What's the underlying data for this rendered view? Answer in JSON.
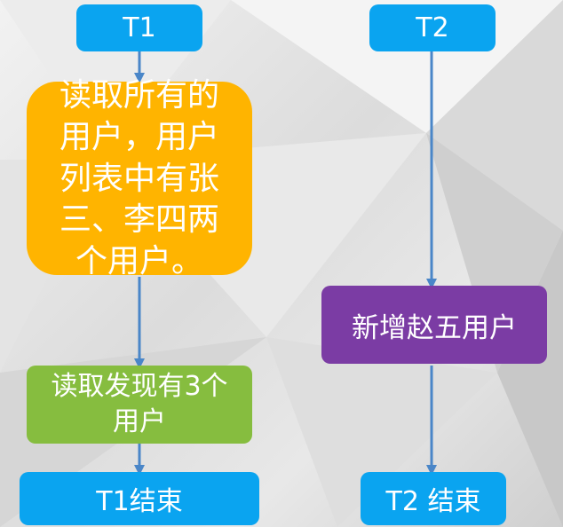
{
  "diagram": {
    "t1_label": "T1",
    "t2_label": "T2",
    "t1_step1_lines": [
      "读取所有的",
      "用户，用户",
      "列表中有张",
      "三、李四两",
      "个用户。"
    ],
    "t1_step2": "读取发现有3个用户",
    "t1_end": "T1结束",
    "t2_step1": "新增赵五用户",
    "t2_end": "T2 结束"
  },
  "colors": {
    "header_blue": "#0aa4f0",
    "orange": "#ffb400",
    "green": "#86bd3f",
    "purple": "#7b3ca4",
    "arrow": "#4a86c8"
  }
}
